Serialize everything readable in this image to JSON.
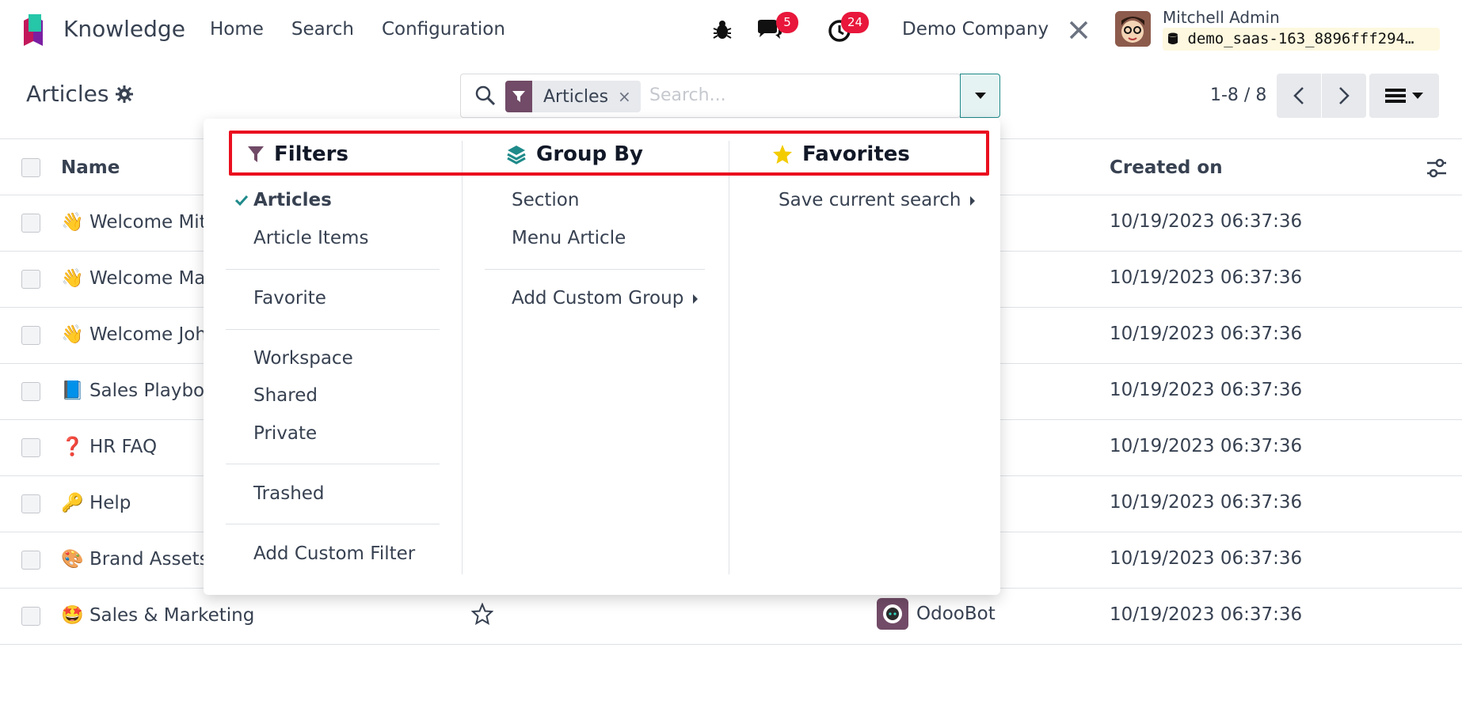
{
  "app": {
    "name": "Knowledge",
    "brand_color": "#714b67",
    "nav": [
      "Home",
      "Search",
      "Configuration"
    ],
    "messages_count": "5",
    "activities_count": "24",
    "company": "Demo Company",
    "user_name": "Mitchell Admin",
    "database": "demo_saas-163_8896fff294…"
  },
  "control_panel": {
    "title": "Articles",
    "facet_label": "Articles",
    "facet_remove": "×",
    "search_placeholder": "Search...",
    "pager": "1-8 / 8"
  },
  "list": {
    "headers": {
      "name": "Name",
      "created_on": "Created on"
    },
    "rows": [
      {
        "name": "👋 Welcome Mit",
        "created_on": "10/19/2023 06:37:36"
      },
      {
        "name": "👋 Welcome Ma",
        "created_on": "10/19/2023 06:37:36"
      },
      {
        "name": "👋 Welcome Joh",
        "created_on": "10/19/2023 06:37:36"
      },
      {
        "name": "📘 Sales Playboo",
        "created_on": "10/19/2023 06:37:36"
      },
      {
        "name": "❓ HR FAQ",
        "created_on": "10/19/2023 06:37:36"
      },
      {
        "name": "🔑 Help",
        "created_on": "10/19/2023 06:37:36"
      },
      {
        "name": "🎨 Brand Assets",
        "created_on": "10/19/2023 06:37:36"
      },
      {
        "name": "🤩 Sales & Marketing",
        "created_on": "10/19/2023 06:37:36",
        "owner": "OdooBot"
      }
    ]
  },
  "dropdown": {
    "filters": {
      "title": "Filters",
      "items": [
        "Articles",
        "Article Items",
        "Favorite",
        "Workspace",
        "Shared",
        "Private",
        "Trashed",
        "Add Custom Filter"
      ],
      "checked": "Articles"
    },
    "group_by": {
      "title": "Group By",
      "items": [
        "Section",
        "Menu Article",
        "Add Custom Group"
      ]
    },
    "favorites": {
      "title": "Favorites",
      "items": [
        "Save current search"
      ]
    },
    "highlight_color": "#ea0f1f"
  }
}
